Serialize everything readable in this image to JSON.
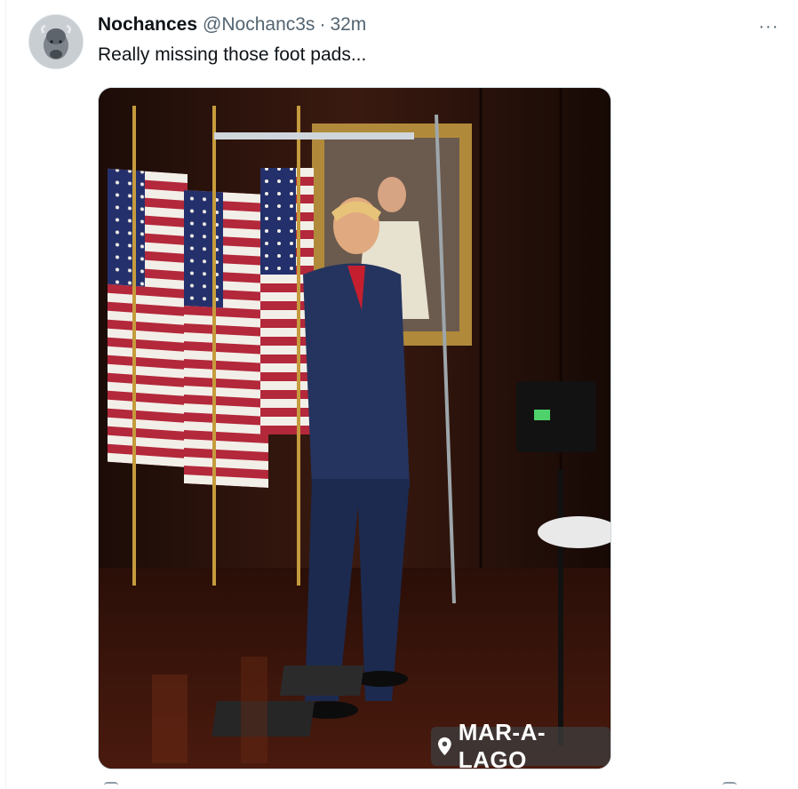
{
  "tweet": {
    "display_name": "Nochances",
    "handle": "@Nochanc3s",
    "separator": "·",
    "time": "32m",
    "more_label": "···",
    "text": "Really missing those foot pads...",
    "media": {
      "location_label": "MAR-A-LAGO"
    }
  },
  "icons": {
    "avatar": "bison-avatar",
    "more": "more-dots-icon",
    "location": "location-pin-icon"
  }
}
